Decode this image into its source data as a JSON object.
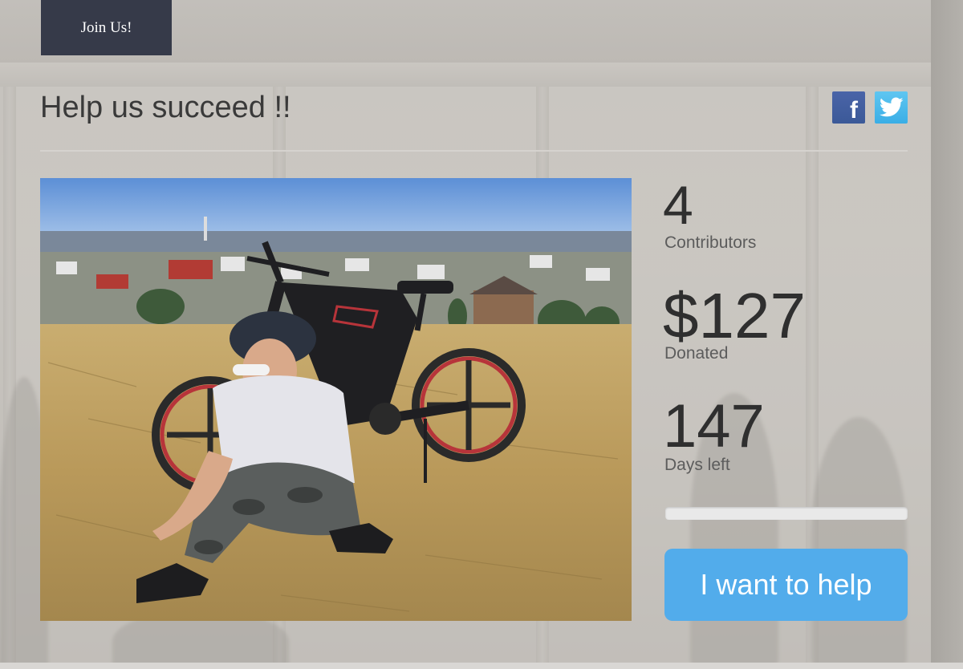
{
  "nav": {
    "join_label": "Join Us!"
  },
  "campaign": {
    "title": "Help us succeed !!",
    "hero_image": "woman-with-helmet-sitting-beside-electric-bike-on-hill"
  },
  "social": {
    "facebook_icon": "facebook-icon",
    "twitter_icon": "twitter-icon",
    "facebook_glyph": "f"
  },
  "stats": {
    "contributors_value": "4",
    "contributors_label": "Contributors",
    "donated_value": "$127",
    "donated_label": "Donated",
    "days_value": "147",
    "days_label": "Days left"
  },
  "progress": {
    "fraction": 0.0
  },
  "cta": {
    "help_label": "I want to help"
  },
  "colors": {
    "nav_button": "#363a49",
    "cta_button": "#52aceb",
    "facebook": "#3b5998",
    "twitter": "#55c2f0"
  }
}
